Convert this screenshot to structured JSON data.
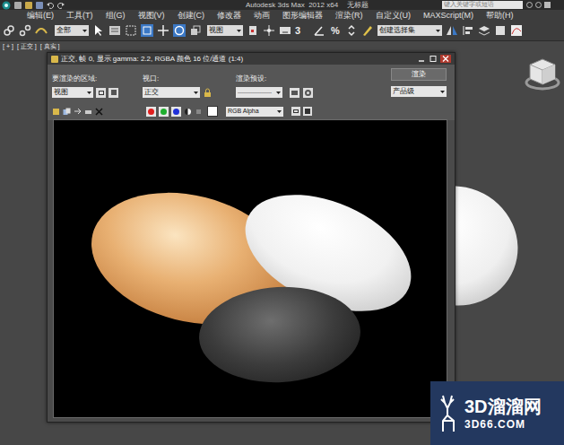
{
  "app": {
    "title": "Autodesk 3ds Max  2012 x64",
    "document": "无标题",
    "search_placeholder": "键入关键字或短语"
  },
  "menu": [
    "编辑(E)",
    "工具(T)",
    "组(G)",
    "视图(V)",
    "创建(C)",
    "修改器",
    "动画",
    "图形编辑器",
    "渲染(R)",
    "自定义(U)",
    "MAXScript(M)",
    "帮助(H)"
  ],
  "toolbar": {
    "selection_filter": "全部",
    "reference_coordinate": "视图",
    "angle_snap": "3",
    "percent_snap": "%",
    "selection_set": "创建选择集"
  },
  "viewport": {
    "labels": [
      "[ + ]",
      "[ 正交 ]",
      "[ 真实 ]"
    ]
  },
  "render_window": {
    "title": "正交, 帧 0, 显示 gamma: 2.2, RGBA 颜色 16 位/通道 (1:4)",
    "area_label": "要渲染的区域:",
    "area_value": "视图",
    "viewport_label": "视口:",
    "viewport_value": "正交",
    "preset_label": "渲染预设:",
    "preset_value": "-------------------",
    "render_button": "渲染",
    "quality": "产品级",
    "channel_display": "RGB Alpha",
    "channels": [
      {
        "name": "red",
        "color": "#e01e1e"
      },
      {
        "name": "green",
        "color": "#1fae2e"
      },
      {
        "name": "blue",
        "color": "#2030d8"
      }
    ]
  },
  "watermark": {
    "brand": "3D溜溜网",
    "url": "3D66.COM"
  }
}
